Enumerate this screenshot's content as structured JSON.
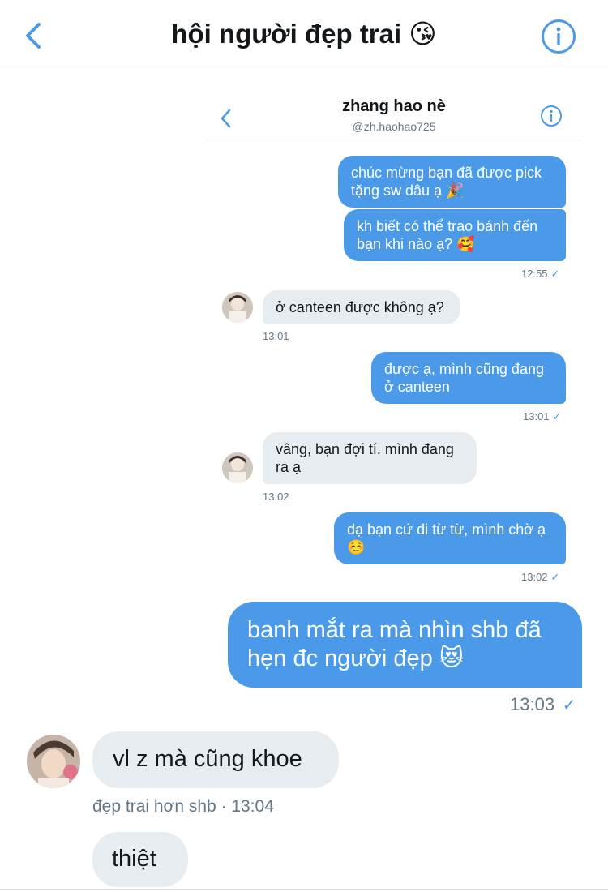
{
  "header": {
    "title": "hội người đẹp trai 😘"
  },
  "embedded": {
    "name": "zhang hao nè",
    "handle": "@zh.haohao725",
    "messages": [
      {
        "text": "chúc mừng bạn đã được pick tặng sw dâu ạ 🎉"
      },
      {
        "text": "kh biết có thể trao bánh đến bạn khi nào ạ? 🥰"
      },
      {
        "time": "12:55"
      },
      {
        "text": "ở canteen được không ạ?",
        "time": "13:01"
      },
      {
        "text": "được ạ, mình cũng đang ở canteen",
        "time": "13:01"
      },
      {
        "text": "vâng, bạn đợi tí. mình đang ra ạ",
        "time": "13:02"
      },
      {
        "text": "dạ bạn cứ đi từ từ, mình chờ ạ ☺️",
        "time": "13:02"
      }
    ]
  },
  "chat": {
    "out_message": "banh mắt ra mà nhìn shb đã hẹn đc người đẹp 😻",
    "out_time": "13:03",
    "in_message_1": "vl z mà cũng khoe",
    "sender_line": "đẹp trai hơn shb · 13:04",
    "in_message_2": "thiệt"
  },
  "colors": {
    "accent": "#4a9ae9",
    "incoming_bubble": "#e7ecf0",
    "muted_text": "#657786"
  },
  "icons": {
    "back": "chevron-left-icon",
    "info": "info-circle-icon",
    "read": "checkmark-icon"
  }
}
